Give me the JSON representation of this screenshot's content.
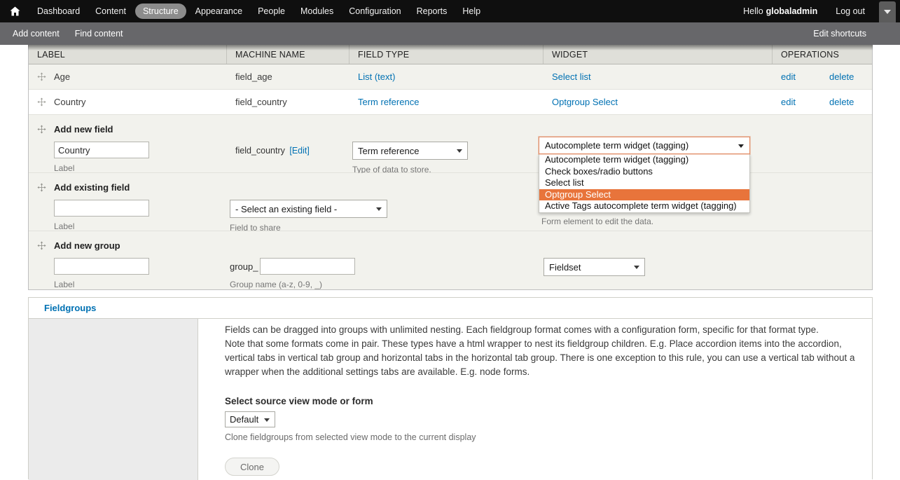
{
  "toolbar": {
    "home_icon": "home-icon",
    "items": [
      {
        "label": "Dashboard",
        "active": false
      },
      {
        "label": "Content",
        "active": false
      },
      {
        "label": "Structure",
        "active": true
      },
      {
        "label": "Appearance",
        "active": false
      },
      {
        "label": "People",
        "active": false
      },
      {
        "label": "Modules",
        "active": false
      },
      {
        "label": "Configuration",
        "active": false
      },
      {
        "label": "Reports",
        "active": false
      },
      {
        "label": "Help",
        "active": false
      }
    ],
    "greeting": "Hello",
    "username": "globaladmin",
    "logout_label": "Log out",
    "toggle_icon": "chevron-down-icon"
  },
  "shortcut_bar": {
    "items": [
      {
        "label": "Add content"
      },
      {
        "label": "Find content"
      }
    ],
    "edit_shortcuts_label": "Edit shortcuts"
  },
  "fields_table": {
    "columns": [
      "LABEL",
      "MACHINE NAME",
      "FIELD TYPE",
      "WIDGET",
      "OPERATIONS"
    ],
    "rows": [
      {
        "label": "Age",
        "machine_name": "field_age",
        "field_type": "List (text)",
        "widget": "Select list",
        "edit_label": "edit",
        "delete_label": "delete"
      },
      {
        "label": "Country",
        "machine_name": "field_country",
        "field_type": "Term reference",
        "widget": "Optgroup Select",
        "edit_label": "edit",
        "delete_label": "delete"
      }
    ],
    "add_new_field": {
      "title": "Add new field",
      "label_value": "Country",
      "label_placeholder": "",
      "label_desc": "Label",
      "machine_name": "field_country",
      "machine_name_edit": "[Edit]",
      "field_type_value": "Term reference",
      "field_type_desc": "Type of data to store.",
      "widget_value": "Autocomplete term widget (tagging)",
      "widget_desc": "Form element to edit the data.",
      "widget_options": [
        {
          "label": "Autocomplete term widget (tagging)",
          "selected": false
        },
        {
          "label": "Check boxes/radio buttons",
          "selected": false
        },
        {
          "label": "Select list",
          "selected": false
        },
        {
          "label": "Optgroup Select",
          "selected": true
        },
        {
          "label": "Active Tags autocomplete term widget (tagging)",
          "selected": false
        }
      ]
    },
    "add_existing_field": {
      "title": "Add existing field",
      "label_value": "",
      "label_desc": "Label",
      "select_value": "- Select an existing field -",
      "select_desc": "Field to share"
    },
    "add_new_group": {
      "title": "Add new group",
      "label_value": "",
      "label_desc": "Label",
      "prefix": "group_",
      "group_name_value": "",
      "group_name_desc": "Group name (a-z, 0-9, _)",
      "format_value": "Fieldset"
    }
  },
  "fieldgroups": {
    "tab_label": "Fieldgroups",
    "paragraphs": [
      "Fields can be dragged into groups with unlimited nesting. Each fieldgroup format comes with a configuration form, specific for that format type.",
      "Note that some formats come in pair. These types have a html wrapper to nest its fieldgroup children. E.g. Place accordion items into the accordion, vertical tabs in vertical tab group and horizontal tabs in the horizontal tab group. There is one exception to this rule, you can use a vertical tab without a wrapper when the additional settings tabs are available. E.g. node forms."
    ],
    "source_label": "Select source view mode or form",
    "source_value": "Default",
    "source_help": "Clone fieldgroups from selected view mode to the current display",
    "clone_label": "Clone"
  },
  "colors": {
    "toolbar_bg": "#0f0f0f",
    "shortcut_bg": "#67676a",
    "link": "#0071b3",
    "highlight": "#e8743b",
    "focus_border": "#e08a63",
    "row_odd": "#f2f2ed",
    "header_bg": "#dfdfd9"
  }
}
